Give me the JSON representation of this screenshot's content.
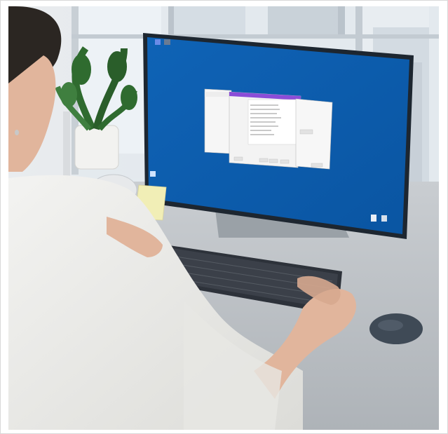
{
  "scene": {
    "description_free": true
  },
  "screen": {
    "background_color": "#0b5cad",
    "desktop_icons": [
      {
        "name": "app-icon-1"
      },
      {
        "name": "app-icon-2"
      },
      {
        "name": "recycle-bin-icon"
      },
      {
        "name": "tray-icon-1"
      },
      {
        "name": "tray-icon-2"
      }
    ],
    "dialog_accent_color": "#8b4dd8"
  }
}
